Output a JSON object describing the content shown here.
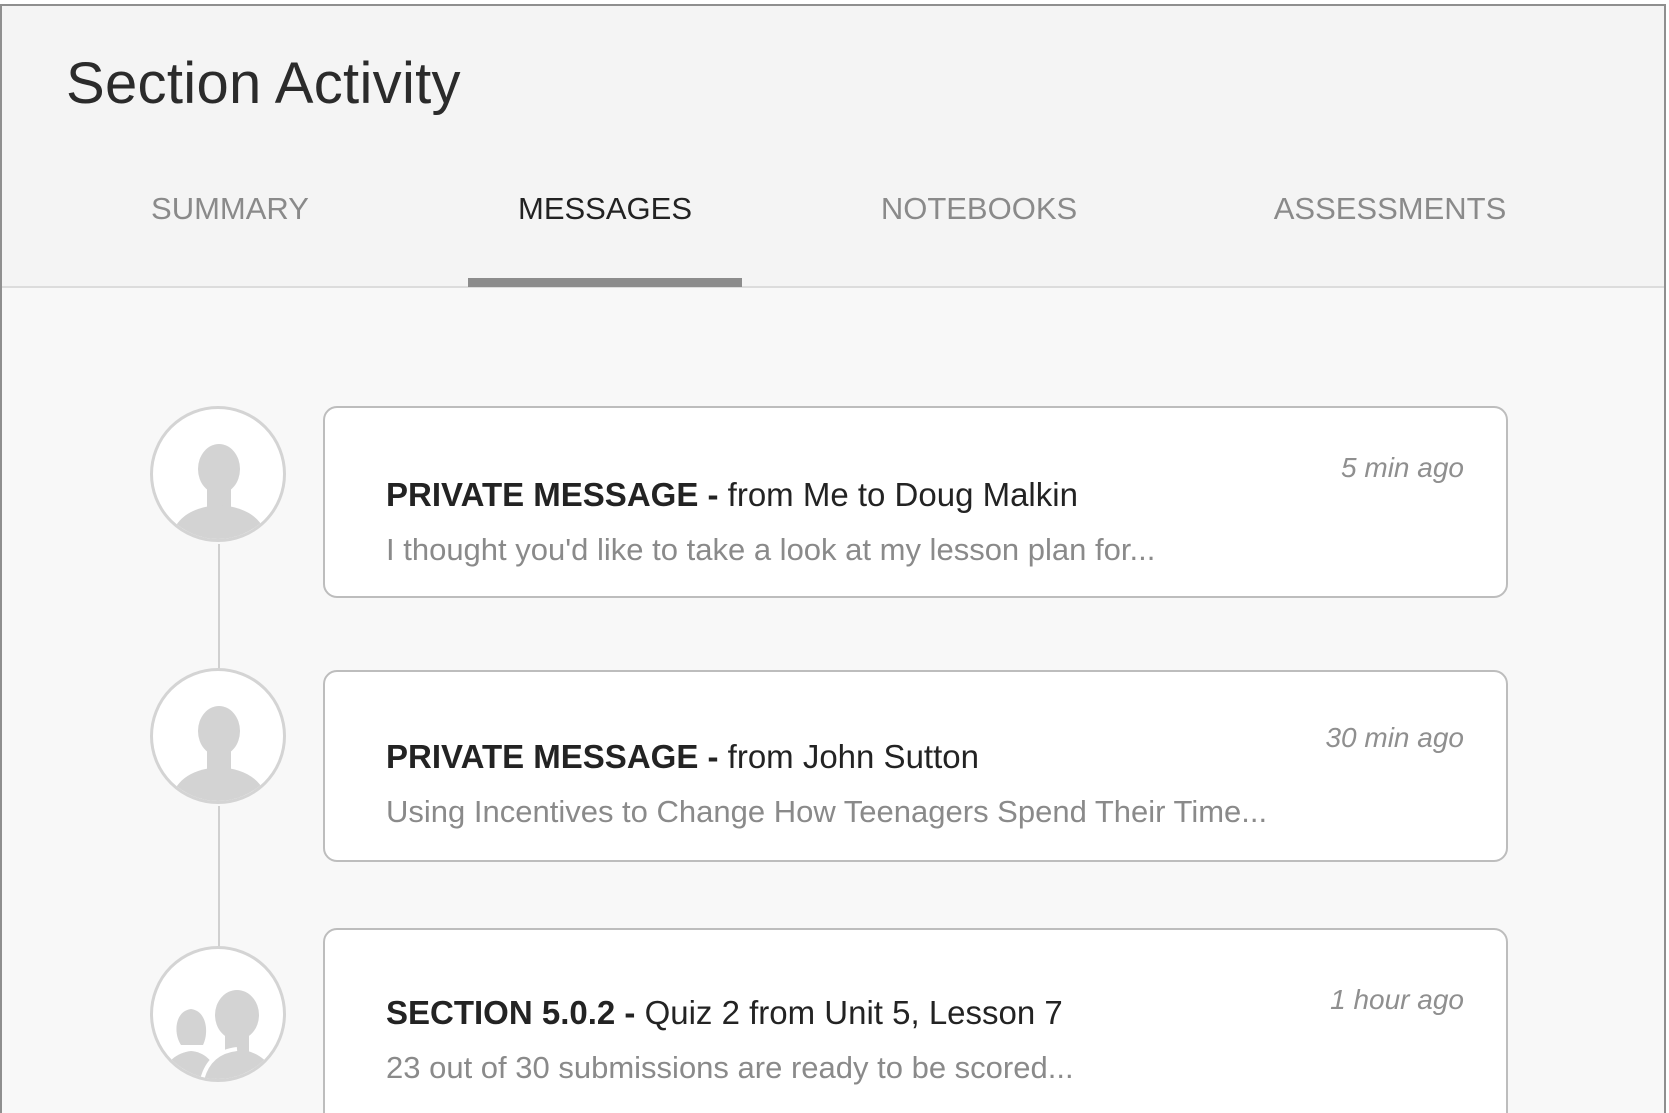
{
  "page": {
    "title": "Section Activity"
  },
  "tabs": [
    {
      "label": "SUMMARY",
      "active": false
    },
    {
      "label": "MESSAGES",
      "active": true
    },
    {
      "label": "NOTEBOOKS",
      "active": false
    },
    {
      "label": "ASSESSMENTS",
      "active": false
    }
  ],
  "activity": [
    {
      "avatar_icon": "person-icon",
      "kind": "PRIVATE MESSAGE -",
      "subject": "from Me to Doug Malkin",
      "preview": "I thought you'd like to take a look at my lesson plan for...",
      "time": "5 min ago"
    },
    {
      "avatar_icon": "person-icon",
      "kind": "PRIVATE MESSAGE -",
      "subject": "from John Sutton",
      "preview": "Using Incentives to Change How Teenagers Spend Their Time...",
      "time": "30 min ago"
    },
    {
      "avatar_icon": "group-icon",
      "kind": "SECTION 5.0.2 -",
      "subject": "Quiz 2 from Unit 5, Lesson 7",
      "preview": "23 out of 30 submissions are ready to be scored...",
      "time": "1 hour ago"
    }
  ],
  "colors": {
    "header_bg": "#f4f4f4",
    "body_bg": "#f8f8f8",
    "active_tab_underline": "#8c8c8c",
    "silhouette": "#d3d3d3"
  }
}
